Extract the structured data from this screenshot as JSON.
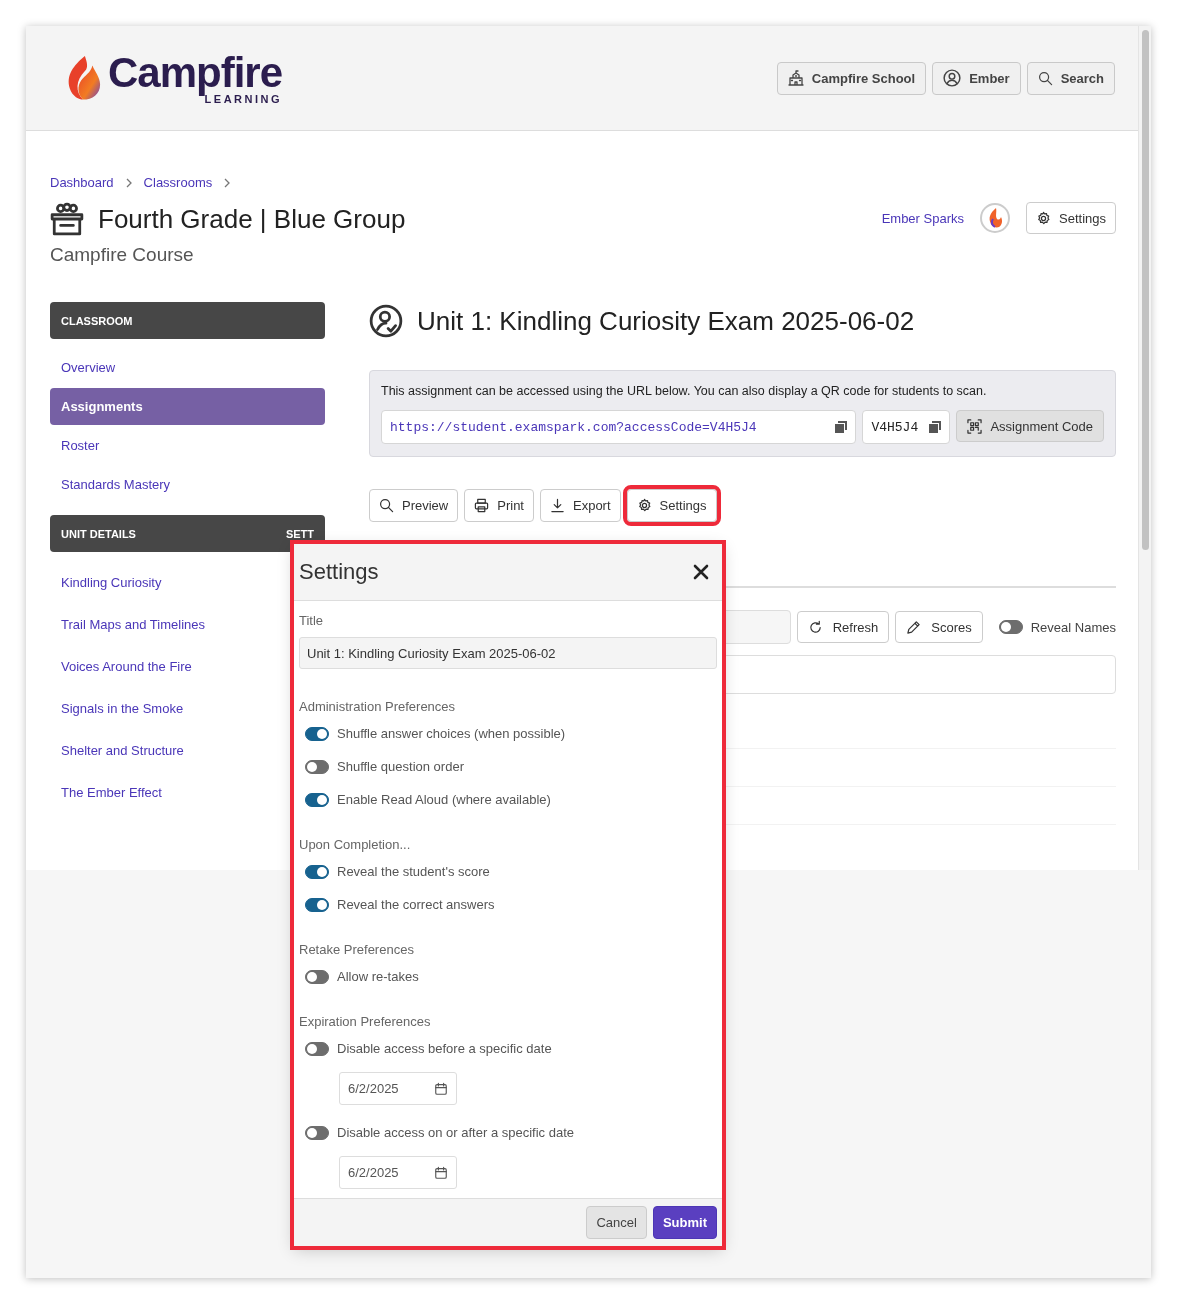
{
  "header": {
    "logo": {
      "name": "Campfire",
      "tagline": "LEARNING"
    },
    "buttons": [
      {
        "kind": "school",
        "label": "Campfire School"
      },
      {
        "kind": "user",
        "label": "Ember"
      },
      {
        "kind": "search",
        "label": "Search"
      }
    ]
  },
  "breadcrumb": [
    "Dashboard",
    "Classrooms"
  ],
  "page": {
    "title": "Fourth Grade | Blue Group",
    "subtitle": "Campfire Course",
    "owner": "Ember Sparks",
    "settings_button": "Settings"
  },
  "sidebar": [
    {
      "heading": "CLASSROOM",
      "items": [
        {
          "label": "Overview",
          "selected": false
        },
        {
          "label": "Assignments",
          "selected": true
        },
        {
          "label": "Roster",
          "selected": false
        },
        {
          "label": "Standards Mastery",
          "selected": false
        }
      ]
    },
    {
      "heading": "UNIT DETAILS",
      "action": "SETT",
      "items": [
        {
          "label": "Kindling Curiosity",
          "selected": false
        },
        {
          "label": "Trail Maps and Timelines",
          "selected": false
        },
        {
          "label": "Voices Around the Fire",
          "selected": false
        },
        {
          "label": "Signals in the Smoke",
          "selected": false
        },
        {
          "label": "Shelter and Structure",
          "selected": false
        },
        {
          "label": "The Ember Effect",
          "selected": false
        }
      ]
    }
  ],
  "assignment": {
    "title": "Unit 1: Kindling Curiosity Exam 2025-06-02",
    "info_text": "This assignment can be accessed using the URL below. You can also display a QR code for students to scan.",
    "url": "https://student.examspark.com?accessCode=V4H5J4",
    "code": "V4H5J4",
    "qr_button": "Assignment Code",
    "actions": [
      {
        "kind": "preview",
        "label": "Preview",
        "highlighted": false
      },
      {
        "kind": "print",
        "label": "Print",
        "highlighted": false
      },
      {
        "kind": "export",
        "label": "Export",
        "highlighted": false
      },
      {
        "kind": "settings",
        "label": "Settings",
        "highlighted": true
      }
    ]
  },
  "toolbar": {
    "buttons": [
      {
        "kind": "refresh",
        "label": "Refresh"
      },
      {
        "kind": "scores",
        "label": "Scores"
      }
    ],
    "reveal_names": {
      "label": "Reveal Names",
      "on": false
    }
  },
  "dialog": {
    "title": "Settings",
    "highlighted": true,
    "field_label": "Title",
    "field_value": "Unit 1: Kindling Curiosity Exam 2025-06-02",
    "sections": [
      {
        "heading": "Administration Preferences",
        "options": [
          {
            "label": "Shuffle answer choices (when possible)",
            "on": true
          },
          {
            "label": "Shuffle question order",
            "on": false
          },
          {
            "label": "Enable Read Aloud (where available)",
            "on": true
          }
        ]
      },
      {
        "heading": "Upon Completion...",
        "options": [
          {
            "label": "Reveal the student's score",
            "on": true
          },
          {
            "label": "Reveal the correct answers",
            "on": true
          }
        ]
      },
      {
        "heading": "Retake Preferences",
        "options": [
          {
            "label": "Allow re-takes",
            "on": false
          }
        ]
      },
      {
        "heading": "Expiration Preferences",
        "options": [
          {
            "label": "Disable access before a specific date",
            "on": false,
            "date": "6/2/2025"
          },
          {
            "label": "Disable access on or after a specific date",
            "on": false,
            "date": "6/2/2025"
          }
        ]
      }
    ],
    "buttons": [
      {
        "kind": "cancel",
        "label": "Cancel"
      },
      {
        "kind": "submit",
        "label": "Submit"
      }
    ]
  }
}
